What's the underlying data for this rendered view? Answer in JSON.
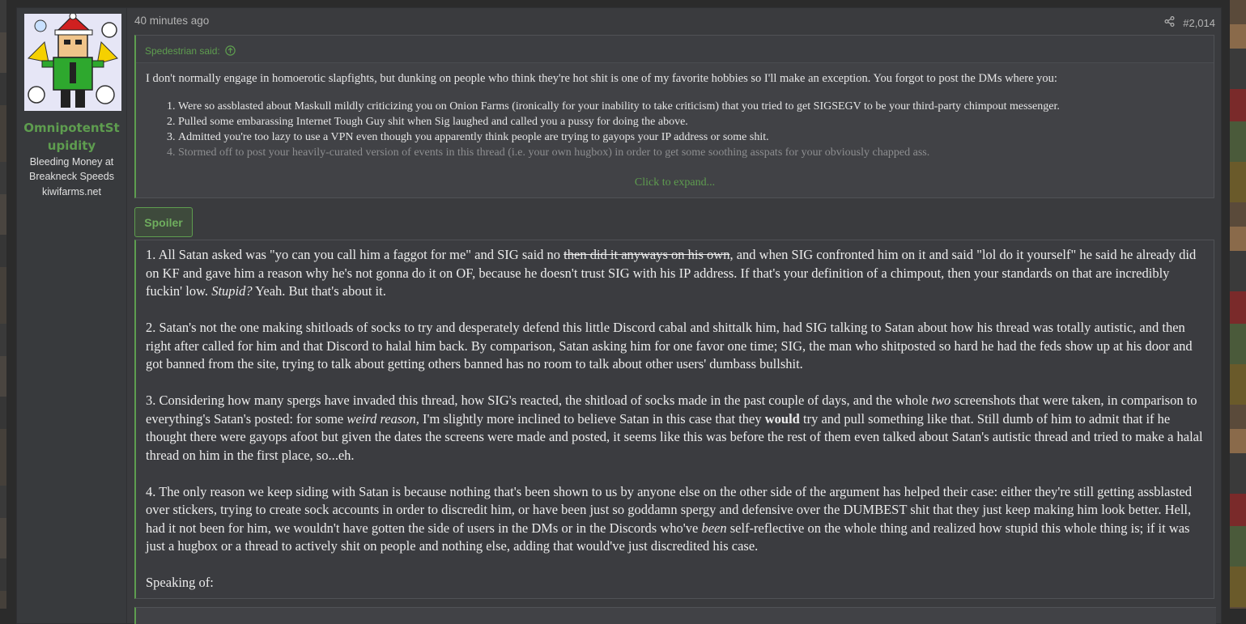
{
  "post": {
    "user": {
      "name": "OmnipotentStupidity",
      "title_line1": "Bleeding Money at",
      "title_line2": "Breakneck Speeds",
      "extra": "kiwifarms.net"
    },
    "time": "40 minutes ago",
    "post_number": "#2,014",
    "quote": {
      "author": "Spedestrian said:",
      "intro": "I don't normally engage in homoerotic slapfights, but dunking on people who think they're hot shit is one of my favorite hobbies so I'll make an exception. You forgot to post the DMs where you:",
      "items": [
        "Were so assblasted about Maskull mildly criticizing you on Onion Farms (ironically for your inability to take criticism) that you tried to get SIGSEGV to be your third-party chimpout messenger.",
        "Pulled some embarassing Internet Tough Guy shit when Sig laughed and called you a pussy for doing the above.",
        "Admitted you're too lazy to use a VPN even though you apparently think people are trying to gayops your IP address or some shit.",
        "Stormed off to post your heavily-curated version of events in this thread (i.e. your own hugbox) in order to get some soothing asspats for your obviously chapped ass."
      ],
      "expand": "Click to expand..."
    },
    "spoiler_label": "Spoiler",
    "body": {
      "p1_a": "1. All Satan asked was \"yo can you call him a faggot for me\" and SIG said no ",
      "p1_strike": "then did it anyways on his own",
      "p1_b": ", and when SIG confronted him on it and said \"lol do it yourself\" he said he already did on KF and gave him a reason why he's not gonna do it on OF, because he doesn't trust SIG with his IP address. If that's your definition of a chimpout, then your standards on that are incredibly fuckin' low. ",
      "p1_italic": "Stupid?",
      "p1_c": " Yeah. But that's about it.",
      "p2": "2. Satan's not the one making shitloads of socks to try and desperately defend this little Discord cabal and shittalk him, had SIG talking to Satan about how his thread was totally autistic, and then right after called for him and that Discord to halal him back. By comparison, Satan asking him for one favor one time; SIG, the man who shitposted so hard he had the feds show up at his door and got banned from the site, trying to talk about getting others banned has no room to talk about other users' dumbass bullshit.",
      "p3_a": "3. Considering how many spergs have invaded this thread, how SIG's reacted, the shitload of socks made in the past couple of days, and the whole ",
      "p3_italic1": "two",
      "p3_b": " screenshots that were taken, in comparison to everything's Satan's posted: for some ",
      "p3_italic2": "weird reason,",
      "p3_c": " I'm slightly more inclined to believe Satan in this case that they ",
      "p3_bold": "would",
      "p3_d": " try and pull something like that. Still dumb of him to admit that if he thought there were gayops afoot but given the dates the screens were made and posted, it seems like this was before the rest of them even talked about Satan's autistic thread and tried to make a halal thread on him in the first place, so...eh.",
      "p4_a": "4. The only reason we keep siding with Satan is because nothing that's been shown to us by anyone else on the other side of the argument has helped their case: either they're still getting assblasted over stickers, trying to create sock accounts in order to discredit him, or have been just so goddamn spergy and defensive over the DUMBEST shit that they just keep making him look better. Hell, had it not been for him, we wouldn't have gotten the side of users in the DMs or in the Discords who've ",
      "p4_italic": "been",
      "p4_b": " self-reflective on the whole thing and realized how stupid this whole thing is; if it was just a hugbox or a thread to actively shit on people and nothing else, adding that would've just discredited his case.",
      "p5": "Speaking of:"
    }
  },
  "colors": {
    "accent": "#5e9d4f",
    "background": "#3a3b3e",
    "text": "#ececec"
  }
}
